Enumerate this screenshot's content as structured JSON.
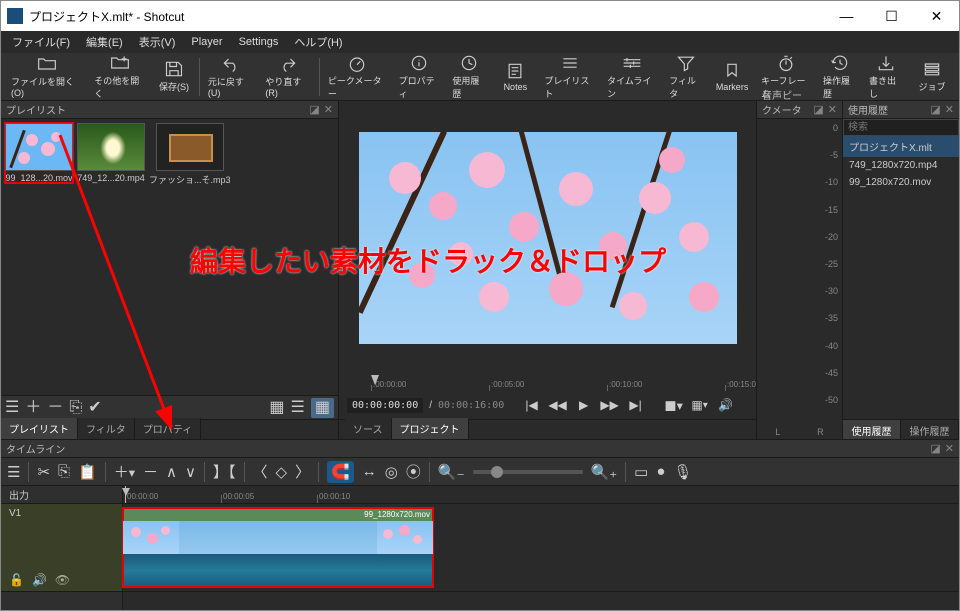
{
  "title": "プロジェクトX.mlt* - Shotcut",
  "menu": {
    "file": "ファイル(F)",
    "edit": "編集(E)",
    "view": "表示(V)",
    "player": "Player",
    "settings": "Settings",
    "help": "ヘルプ(H)"
  },
  "toolbar": {
    "open": "ファイルを開く(O)",
    "open_other": "その他を開く",
    "save": "保存(S)",
    "undo": "元に戻す(U)",
    "redo": "やり直す(R)",
    "peak": "ピークメーター",
    "prop": "プロパティ",
    "recent": "使用履歴",
    "notes": "Notes",
    "playlist": "プレイリスト",
    "timeline": "タイムライン",
    "filters": "フィルタ",
    "markers": "Markers",
    "keyframes": "キーフレーム",
    "history": "操作履歴",
    "export": "書き出し",
    "jobs": "ジョブ"
  },
  "panels": {
    "playlist": "プレイリスト",
    "meter": "音声ピークメーター",
    "history": "使用履歴",
    "timeline": "タイムライン"
  },
  "clips": [
    {
      "name": "99_128...20.mov"
    },
    {
      "name": "749_12...20.mp4"
    },
    {
      "name": "ファッショ...そ.mp3"
    }
  ],
  "history_search": "検索",
  "history_items": [
    "プロジェクトX.mlt",
    "749_1280x720.mp4",
    "99_1280x720.mov"
  ],
  "meter_ticks": [
    "0",
    "-5",
    "-10",
    "-15",
    "-20",
    "-25",
    "-30",
    "-35",
    "-40",
    "-45",
    "-50"
  ],
  "meter_lr": {
    "l": "L",
    "r": "R"
  },
  "transport": {
    "ruler": [
      ":00:00:00",
      ":00:05:00",
      ":00:10:00",
      ":00:15:0"
    ],
    "tc_current": "00:00:00:00",
    "tc_sep": "/",
    "tc_total": "00:00:16:00"
  },
  "preview_tabs": {
    "source": "ソース",
    "project": "プロジェクト"
  },
  "playlist_tabs": {
    "playlist": "プレイリスト",
    "filters": "フィルタ",
    "properties": "プロパティ"
  },
  "history_tabs": {
    "recent": "使用履歴",
    "ops": "操作履歴"
  },
  "tl_ruler": [
    "00:00:00",
    "00:00:05",
    "00:00:10"
  ],
  "tl_tracks": {
    "output": "出力",
    "v1": "V1"
  },
  "tl_clip_label": "99_1280x720.mov",
  "annotation": "編集したい素材をドラック＆ドロップ"
}
